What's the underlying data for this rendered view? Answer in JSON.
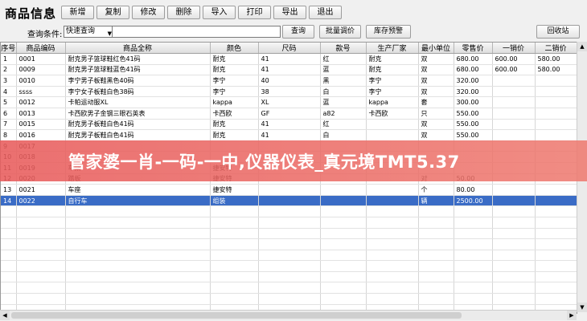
{
  "app": {
    "title": "商品信息"
  },
  "toolbar": {
    "buttons": [
      "新增",
      "复制",
      "修改",
      "删除",
      "导入",
      "打印",
      "导出",
      "退出"
    ]
  },
  "search": {
    "label": "查询条件:",
    "mode_value": "快速查询",
    "input_value": "",
    "query_button": "查询",
    "batch_price_button": "批量调价",
    "stock_alert_button": "库存预警",
    "recycle_button": "回收站"
  },
  "table": {
    "columns": [
      "序号",
      "商品编码",
      "商品全称",
      "颜色",
      "尺码",
      "款号",
      "生产厂家",
      "最小单位",
      "零售价",
      "一销价",
      "二销价"
    ],
    "rows": [
      [
        "1",
        "0001",
        "耐克男子篮球鞋红色41码",
        "耐克",
        "41",
        "红",
        "耐克",
        "双",
        "680.00",
        "600.00",
        "580.00"
      ],
      [
        "2",
        "0009",
        "耐克男子篮球鞋蓝色41码",
        "耐克",
        "41",
        "蓝",
        "耐克",
        "双",
        "680.00",
        "600.00",
        "580.00"
      ],
      [
        "3",
        "0010",
        "李宁男子板鞋黑色40码",
        "李宁",
        "40",
        "黑",
        "李宁",
        "双",
        "320.00",
        "",
        ""
      ],
      [
        "4",
        "ssss",
        "李宁女子板鞋白色38码",
        "李宁",
        "38",
        "白",
        "李宁",
        "双",
        "320.00",
        "",
        ""
      ],
      [
        "5",
        "0012",
        "卡帕运动服XL",
        "kappa",
        "XL",
        "蓝",
        "kappa",
        "套",
        "300.00",
        "",
        ""
      ],
      [
        "6",
        "0013",
        "卡西欧男子金钢三眼石英表",
        "卡西欧",
        "GF",
        "a82",
        "卡西欧",
        "只",
        "550.00",
        "",
        ""
      ],
      [
        "7",
        "0015",
        "耐克男子板鞋白色41码",
        "耐克",
        "41",
        "红",
        "",
        "双",
        "550.00",
        "",
        ""
      ],
      [
        "8",
        "0016",
        "耐克男子板鞋白色41码",
        "耐克",
        "41",
        "白",
        "",
        "双",
        "550.00",
        "",
        ""
      ],
      [
        "9",
        "0017",
        "",
        "",
        "",
        "",
        "",
        "",
        "",
        "",
        ""
      ],
      [
        "10",
        "0018",
        "",
        "",
        "",
        "",
        "",
        "",
        "",
        "",
        ""
      ],
      [
        "11",
        "0019",
        "车架",
        "捷安特",
        "",
        "",
        "",
        "",
        "",
        "",
        ""
      ],
      [
        "12",
        "0020",
        "踏板",
        "捷安特",
        "",
        "",
        "",
        "对",
        "50.00",
        "",
        ""
      ],
      [
        "13",
        "0021",
        "车座",
        "捷安特",
        "",
        "",
        "",
        "个",
        "80.00",
        "",
        ""
      ],
      [
        "14",
        "0022",
        "自行车",
        "组装",
        "",
        "",
        "",
        "辆",
        "2500.00",
        "",
        ""
      ]
    ],
    "selected_row": 13,
    "empty_rows": 10
  },
  "watermark": {
    "text": "管家婆一肖-一码-一中,仪器仪表_真元境TMT5.37"
  }
}
